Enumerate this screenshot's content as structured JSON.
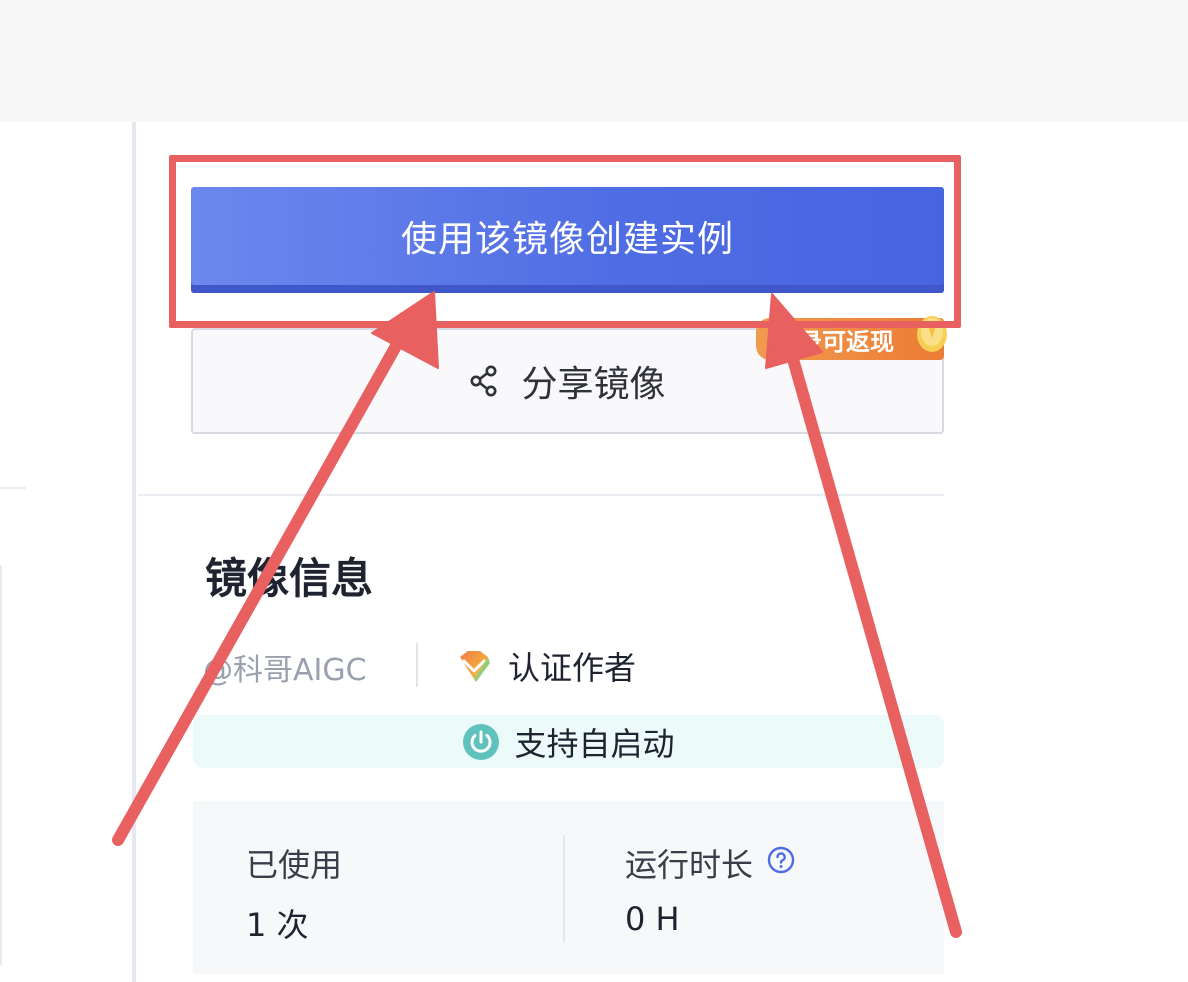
{
  "actions": {
    "create_instance_label": "使用该镜像创建实例",
    "share_label": "分享镜像",
    "promo_badge": "录可返现"
  },
  "image_info": {
    "title": "镜像信息",
    "author": "@科哥AIGC",
    "verified_label": "认证作者",
    "autostart_label": "支持自启动"
  },
  "stats": {
    "used_label": "已使用",
    "used_value": "1 次",
    "runtime_label": "运行时长",
    "runtime_value": "0 H"
  },
  "colors": {
    "primary": "#4e6ce3",
    "annotation": "#e8605f",
    "promo": "#ee8a40",
    "autostart_bg": "#ecfafa",
    "power_icon": "#5fc2bd"
  },
  "icons": {
    "share": "share-icon",
    "verified": "diamond-badge-icon",
    "autostart": "power-icon",
    "help": "question-circle-icon",
    "coin": "coin-icon"
  }
}
